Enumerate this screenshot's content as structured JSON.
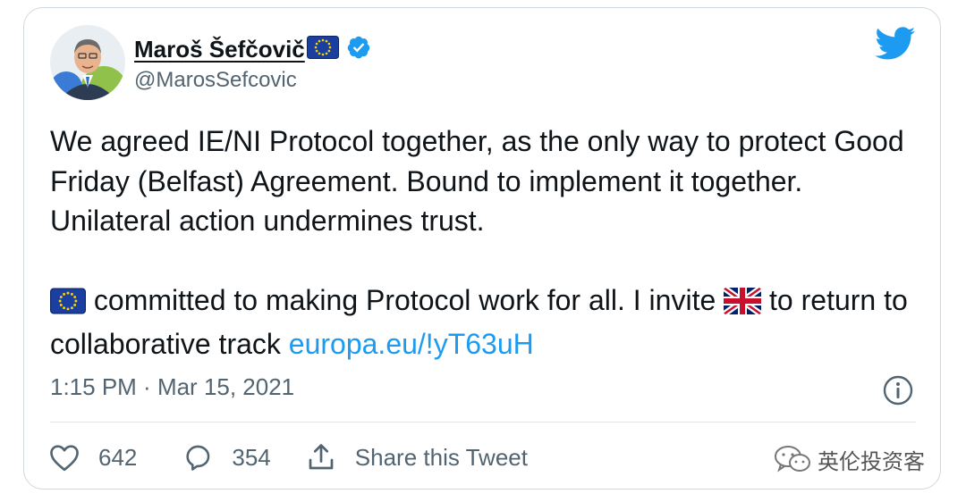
{
  "author": {
    "display_name": "Maroš Šefčovič",
    "handle": "@MarosSefcovic",
    "verified": true,
    "name_emoji": "eu-flag-icon"
  },
  "tweet": {
    "paragraph1": "We agreed IE/NI Protocol together, as the only way to protect Good Friday (Belfast) Agreement. Bound to implement it together. Unilateral action undermines trust.",
    "paragraph2_part1": " committed to making Protocol work for all. I invite ",
    "paragraph2_part2": " to return to  collaborative track ",
    "link": "europa.eu/!yT63uH",
    "emoji1": "eu-flag-icon",
    "emoji2": "uk-flag-icon"
  },
  "meta": {
    "time": "1:15 PM",
    "separator": " · ",
    "date": "Mar 15, 2021"
  },
  "actions": {
    "likes": "642",
    "replies": "354",
    "share_label": "Share this Tweet"
  },
  "watermark": {
    "text": "英伦投资客",
    "icon": "wechat-icon"
  },
  "colors": {
    "link": "#1d9bf0",
    "secondary_text": "#536471",
    "verified": "#1d9bf0",
    "border": "#cfd9de"
  }
}
